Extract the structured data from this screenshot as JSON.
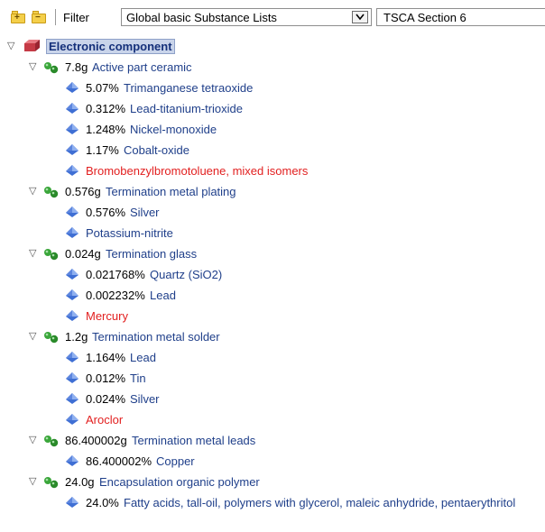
{
  "toolbar": {
    "expand_icon": "folder-plus-icon",
    "collapse_icon": "folder-minus-icon",
    "filter_label": "Filter",
    "filter_value": "Global basic Substance Lists",
    "list_value": "TSCA Section 6"
  },
  "tree": {
    "root": {
      "label": "Electronic component",
      "icon": "component-icon"
    },
    "groups": [
      {
        "qty": "7.8g",
        "name": "Active part ceramic",
        "items": [
          {
            "qty": "5.07%",
            "name": "Trimanganese tetraoxide",
            "flagged": false
          },
          {
            "qty": "0.312%",
            "name": "Lead-titanium-trioxide",
            "flagged": false
          },
          {
            "qty": "1.248%",
            "name": "Nickel-monoxide",
            "flagged": false
          },
          {
            "qty": "1.17%",
            "name": "Cobalt-oxide",
            "flagged": false
          },
          {
            "qty": "",
            "name": "Bromobenzylbromotoluene, mixed isomers",
            "flagged": true
          }
        ]
      },
      {
        "qty": "0.576g",
        "name": "Termination metal plating",
        "items": [
          {
            "qty": "0.576%",
            "name": "Silver",
            "flagged": false
          },
          {
            "qty": "",
            "name": "Potassium-nitrite",
            "flagged": false
          }
        ]
      },
      {
        "qty": "0.024g",
        "name": "Termination glass",
        "items": [
          {
            "qty": "0.021768%",
            "name": "Quartz (SiO2)",
            "flagged": false
          },
          {
            "qty": "0.002232%",
            "name": "Lead",
            "flagged": false
          },
          {
            "qty": "",
            "name": "Mercury",
            "flagged": true
          }
        ]
      },
      {
        "qty": "1.2g",
        "name": "Termination metal solder",
        "items": [
          {
            "qty": "1.164%",
            "name": "Lead",
            "flagged": false
          },
          {
            "qty": "0.012%",
            "name": "Tin",
            "flagged": false
          },
          {
            "qty": "0.024%",
            "name": "Silver",
            "flagged": false
          },
          {
            "qty": "",
            "name": "Aroclor",
            "flagged": true
          }
        ]
      },
      {
        "qty": "86.400002g",
        "name": "Termination metal leads",
        "items": [
          {
            "qty": "86.400002%",
            "name": "Copper",
            "flagged": false
          }
        ]
      },
      {
        "qty": "24.0g",
        "name": "Encapsulation organic polymer",
        "items": [
          {
            "qty": "24.0%",
            "name": "Fatty acids, tall-oil, polymers with glycerol, maleic anhydride, pentaerythritol",
            "flagged": false
          }
        ]
      }
    ]
  },
  "colors": {
    "name_text": "#1f3f8a",
    "flagged_text": "#e21f1f",
    "material_icon": "#2f9a2f",
    "substance_icon": "#3f6fd4",
    "root_icon": "#d8404b"
  }
}
